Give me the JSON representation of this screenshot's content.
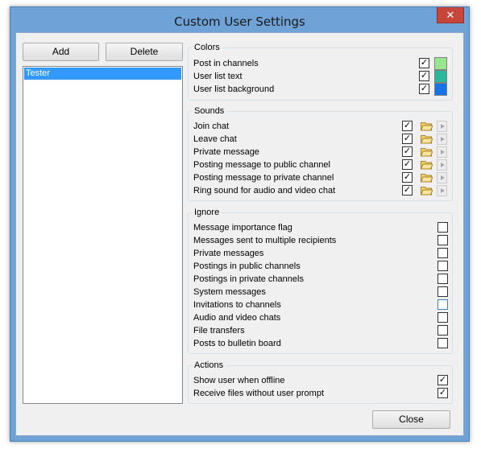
{
  "window": {
    "title": "Custom User Settings",
    "close_glyph": "✕"
  },
  "toolbar": {
    "add_label": "Add",
    "delete_label": "Delete"
  },
  "users": {
    "items": [
      "Tester"
    ],
    "selected": "Tester"
  },
  "colors": {
    "label": "Colors",
    "items": [
      {
        "label": "Post in channels",
        "checked": true,
        "color": "#98e68e"
      },
      {
        "label": "User list text",
        "checked": true,
        "color": "#2bb79a"
      },
      {
        "label": "User list background",
        "checked": true,
        "color": "#1873e6"
      }
    ]
  },
  "sounds": {
    "label": "Sounds",
    "items": [
      {
        "label": "Join chat",
        "checked": true
      },
      {
        "label": "Leave chat",
        "checked": true
      },
      {
        "label": "Private message",
        "checked": true
      },
      {
        "label": "Posting message to public channel",
        "checked": true
      },
      {
        "label": "Posting message to private channel",
        "checked": true
      },
      {
        "label": "Ring sound for audio and video chat",
        "checked": true
      }
    ]
  },
  "ignore": {
    "label": "Ignore",
    "items": [
      {
        "label": "Message importance flag",
        "checked": false
      },
      {
        "label": "Messages sent to multiple recipients",
        "checked": false
      },
      {
        "label": "Private messages",
        "checked": false
      },
      {
        "label": "Postings in public channels",
        "checked": false
      },
      {
        "label": "Postings in private channels",
        "checked": false
      },
      {
        "label": "System messages",
        "checked": false
      },
      {
        "label": "Invitations to channels",
        "checked": false
      },
      {
        "label": "Audio and video chats",
        "checked": false
      },
      {
        "label": "File transfers",
        "checked": false
      },
      {
        "label": "Posts to bulletin board",
        "checked": false
      }
    ]
  },
  "actions": {
    "label": "Actions",
    "items": [
      {
        "label": "Show user when offline",
        "checked": true
      },
      {
        "label": "Receive files without user prompt",
        "checked": true
      }
    ]
  },
  "footer": {
    "close_label": "Close"
  }
}
